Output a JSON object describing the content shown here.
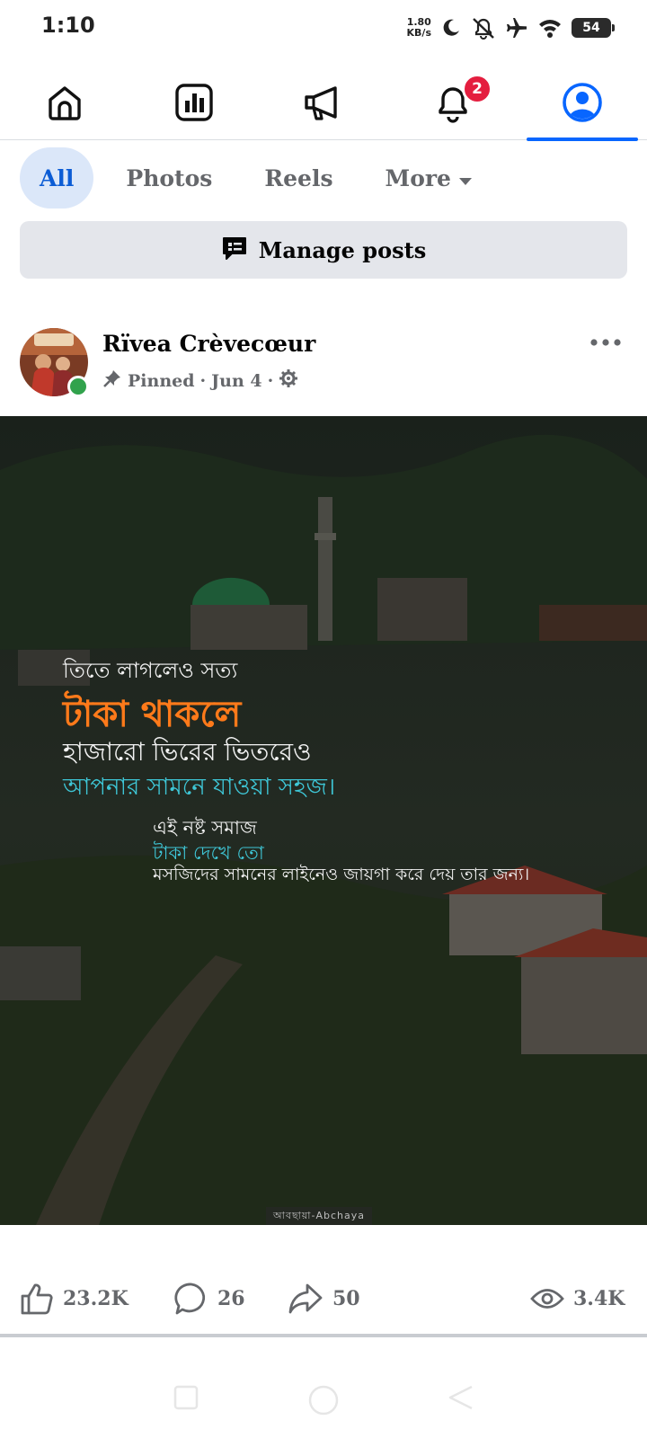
{
  "status_bar": {
    "time": "1:10",
    "net_speed_value": "1.80",
    "net_speed_unit": "KB/s",
    "battery": "54",
    "icons": [
      "moon-icon",
      "mute-icon",
      "airplane-icon",
      "wifi-icon",
      "battery-icon"
    ]
  },
  "top_nav": {
    "items": [
      {
        "name": "home",
        "icon": "home-icon"
      },
      {
        "name": "dashboard",
        "icon": "bar-chart-icon"
      },
      {
        "name": "ads",
        "icon": "megaphone-icon"
      },
      {
        "name": "notifications",
        "icon": "bell-icon",
        "badge": "2"
      },
      {
        "name": "profile",
        "icon": "profile-icon",
        "active": true
      }
    ],
    "accent_color": "#0866ff",
    "badge_color": "#e41e3f"
  },
  "filter_tabs": {
    "all": "All",
    "photos": "Photos",
    "reels": "Reels",
    "more": "More"
  },
  "manage_posts": {
    "label": "Manage posts"
  },
  "post": {
    "author": "Rïvea Crèvecœur",
    "pinned": "Pinned",
    "separator": "·",
    "date": "Jun 4",
    "image": {
      "lines": [
        "তিতে লাগলেও সত্য",
        "টাকা থাকলে",
        "হাজারো ভিরের ভিতরেও",
        "আপনার সামনে যাওয়া সহজ।",
        "এই নষ্ট সমাজ",
        "টাকা দেখে তো",
        "মসজিদের সামনের লাইনেও জায়গা করে দেয় তার জন্য।"
      ],
      "watermark": "আবছায়া-Abchaya"
    },
    "stats": {
      "likes": "23.2K",
      "comments": "26",
      "shares": "50",
      "views": "3.4K"
    }
  }
}
